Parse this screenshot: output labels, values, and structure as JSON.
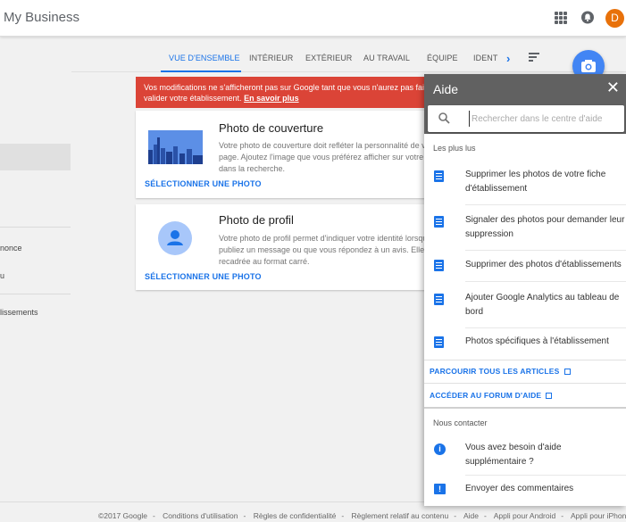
{
  "header": {
    "brand": "My Business",
    "avatar_letter": "D"
  },
  "leftnav": {
    "items": [
      "nonce",
      "u",
      "lissements"
    ]
  },
  "tabs": [
    {
      "label": "VUE D'ENSEMBLE",
      "active": true
    },
    {
      "label": "INTÉRIEUR"
    },
    {
      "label": "EXTÉRIEUR"
    },
    {
      "label": "AU TRAVAIL"
    },
    {
      "label": "ÉQUIPE"
    },
    {
      "label": "IDENT"
    }
  ],
  "banner": {
    "text": "Vos modifications ne s'afficheront pas sur Google tant que vous n'aurez pas fait valider votre établissement.",
    "link": "En savoir plus",
    "color": "#db4437"
  },
  "cards": {
    "cover": {
      "title": "Photo de couverture",
      "description": "Votre photo de couverture doit refléter la personnalité de votre page. Ajoutez l'image que vous préférez afficher sur votre fiche dans la recherche.",
      "action": "SÉLECTIONNER UNE PHOTO"
    },
    "profile": {
      "title": "Photo de profil",
      "description": "Votre photo de profil permet d'indiquer votre identité lorsque vous publiez un message ou que vous répondez à un avis. Elle sera recadrée au format carré.",
      "action": "SÉLECTIONNER UNE PHOTO"
    }
  },
  "help": {
    "title": "Aide",
    "search_placeholder": "Rechercher dans le centre d'aide",
    "popular_label": "Les plus lus",
    "articles": [
      {
        "line1": "Supprimer les photos de votre fiche",
        "line2": "d'établissement"
      },
      {
        "line1": "Signaler des photos pour demander leur",
        "line2": "suppression"
      },
      {
        "line1": "Supprimer des photos d'établissements",
        "line2": ""
      },
      {
        "line1": "Ajouter Google Analytics au tableau de",
        "line2": "bord"
      },
      {
        "line1": "Photos spécifiques à l'établissement",
        "line2": ""
      }
    ],
    "browse_link": "PARCOURIR TOUS LES ARTICLES",
    "forum_link": "ACCÉDER AU FORUM D'AIDE",
    "contact_label": "Nous contacter",
    "contact_items": [
      {
        "line1": "Vous avez besoin d'aide",
        "line2": "supplémentaire ?"
      },
      {
        "line1": "Envoyer des commentaires",
        "line2": ""
      }
    ]
  },
  "footer": {
    "links": [
      "©2017 Google",
      "Conditions d'utilisation",
      "Règles de confidentialité",
      "Règlement relatif au contenu",
      "Aide",
      "Appli pour Android",
      "Appli pour iPhone"
    ]
  },
  "colors": {
    "accent": "#1a73e8",
    "help_header": "#616161",
    "avatar": "#e8710a"
  }
}
